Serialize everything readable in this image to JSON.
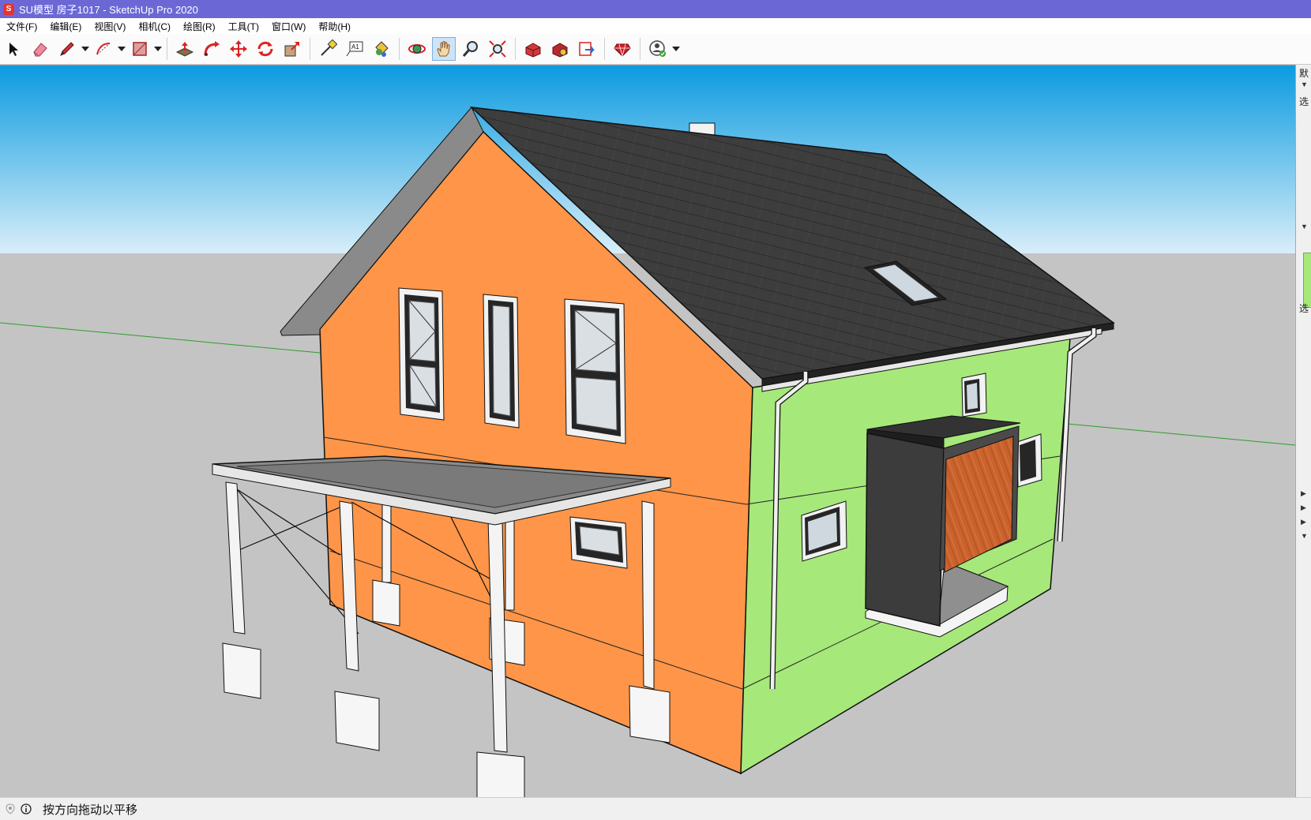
{
  "window": {
    "title": "SU模型 房子1017 - SketchUp Pro 2020",
    "logo_letter": "S"
  },
  "menu": [
    "文件(F)",
    "编辑(E)",
    "视图(V)",
    "相机(C)",
    "绘图(R)",
    "工具(T)",
    "窗口(W)",
    "帮助(H)"
  ],
  "toolbar": [
    {
      "icon": "select-arrow-icon"
    },
    {
      "icon": "eraser-icon"
    },
    {
      "icon": "pencil-line-icon",
      "dropdown": true
    },
    {
      "icon": "arc-icon",
      "dropdown": true
    },
    {
      "icon": "rectangle-icon",
      "dropdown": true
    },
    {
      "sep": true
    },
    {
      "icon": "push-pull-icon"
    },
    {
      "icon": "offset-icon"
    },
    {
      "icon": "move-icon"
    },
    {
      "icon": "rotate-icon"
    },
    {
      "icon": "scale-icon"
    },
    {
      "sep": true
    },
    {
      "icon": "tape-measure-icon"
    },
    {
      "icon": "text-icon"
    },
    {
      "icon": "paint-bucket-icon"
    },
    {
      "sep": true
    },
    {
      "icon": "orbit-icon"
    },
    {
      "icon": "pan-hand-icon",
      "active": true
    },
    {
      "icon": "zoom-icon"
    },
    {
      "icon": "zoom-extents-icon"
    },
    {
      "sep": true
    },
    {
      "icon": "warehouse-icon"
    },
    {
      "icon": "extension-warehouse-icon"
    },
    {
      "icon": "layout-send-icon"
    },
    {
      "sep": true
    },
    {
      "icon": "extension-ruby-icon"
    },
    {
      "sep": true
    },
    {
      "icon": "user-account-icon",
      "dropdown": true
    }
  ],
  "status": {
    "text": "按方向拖动以平移"
  },
  "tray": {
    "chars": [
      "默",
      "选",
      "选"
    ]
  },
  "colors": {
    "sky_top": "#0c9be0",
    "sky_bottom": "#d8eef9",
    "ground": "#c4c4c4",
    "wall_orange": "#fe9548",
    "wall_green": "#a6e87a",
    "roof": "#3d3d3d",
    "titlebar": "#6b68d6",
    "axis_green": "#2e9c2e"
  }
}
